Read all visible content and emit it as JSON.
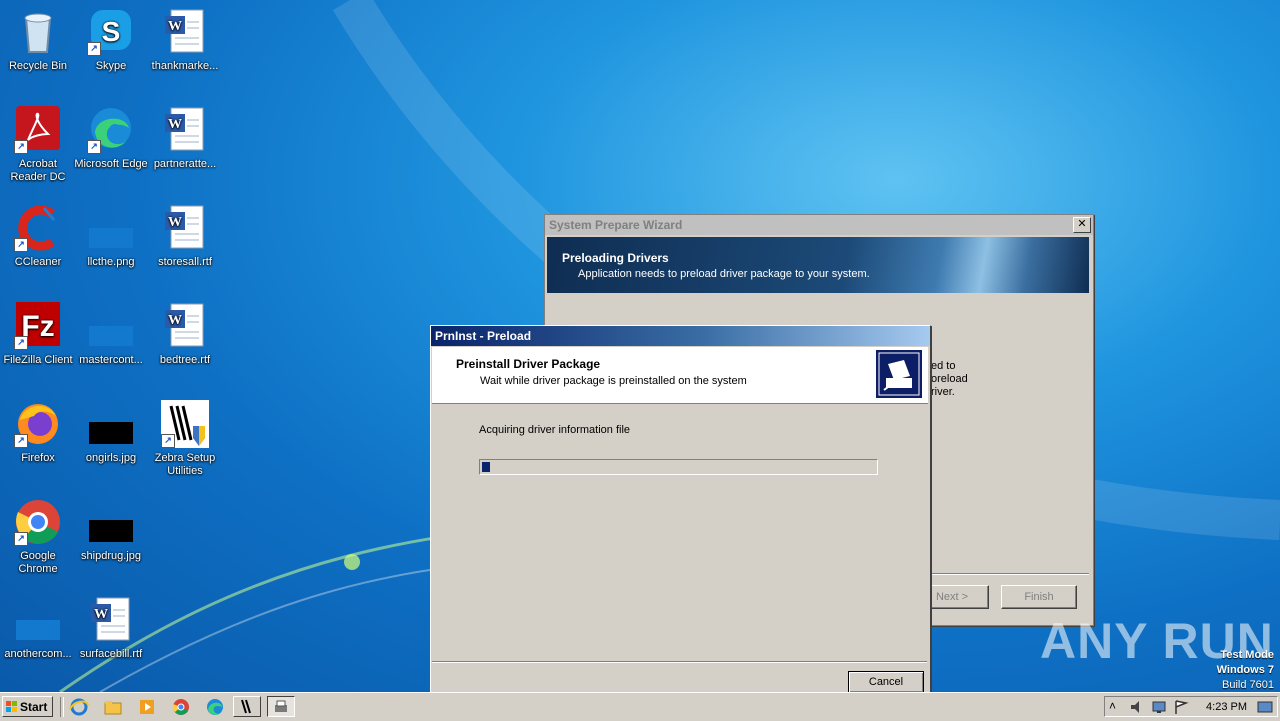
{
  "desktop_icons": [
    {
      "label": "Recycle Bin"
    },
    {
      "label": "Skype"
    },
    {
      "label": "thankmarke..."
    },
    {
      "label": "Acrobat Reader DC"
    },
    {
      "label": "Microsoft Edge"
    },
    {
      "label": "partneratte..."
    },
    {
      "label": "CCleaner"
    },
    {
      "label": "llcthe.png"
    },
    {
      "label": "storesall.rtf"
    },
    {
      "label": "FileZilla Client"
    },
    {
      "label": "mastercont..."
    },
    {
      "label": "bedtree.rtf"
    },
    {
      "label": "Firefox"
    },
    {
      "label": "ongirls.jpg"
    },
    {
      "label": "Zebra Setup Utilities"
    },
    {
      "label": "Google Chrome"
    },
    {
      "label": "shipdrug.jpg"
    },
    {
      "label": "anothercom..."
    },
    {
      "label": "surfacebill.rtf"
    }
  ],
  "wizard": {
    "title": "System Prepare Wizard",
    "close": "✕",
    "heading": "Preloading Drivers",
    "subheading": "Application needs to preload driver package to your system.",
    "body_fragment_1": "ed to",
    "body_fragment_2": "oreload",
    "body_fragment_3": "river.",
    "next_label": "Next >",
    "finish_label": "Finish"
  },
  "preload": {
    "title": "PrnInst - Preload",
    "heading": "Preinstall Driver Package",
    "subheading": "Wait while driver package is preinstalled on the system",
    "status": "Acquiring driver information file",
    "progress": 0.02,
    "cancel_label": "Cancel"
  },
  "taskbar": {
    "start_label": "Start",
    "clock": "4:23 PM"
  },
  "os_watermark": {
    "line1": "Test Mode",
    "line2": "Windows 7",
    "line3": "Build 7601"
  },
  "brand_watermark": "ANY RUN",
  "colors": {
    "titlebar_active": "#0a246a",
    "window_face": "#d4d0c8",
    "progress_fill": "#0a246a"
  }
}
